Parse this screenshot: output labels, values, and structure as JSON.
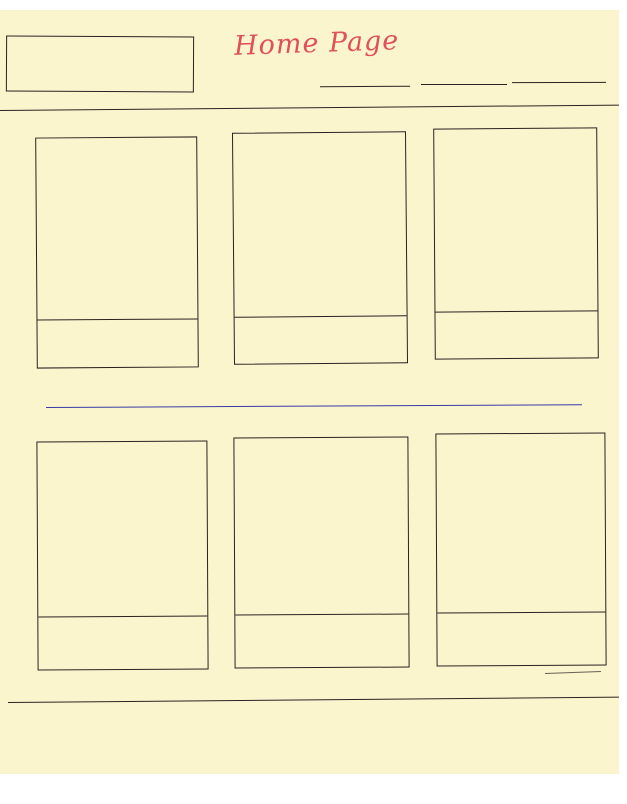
{
  "header": {
    "title": "Home Page"
  },
  "colors": {
    "paper": "#fbf5cd",
    "ink": "#2a2222",
    "title_ink": "#e0505a",
    "separator_ink": "#3a3aa8"
  }
}
